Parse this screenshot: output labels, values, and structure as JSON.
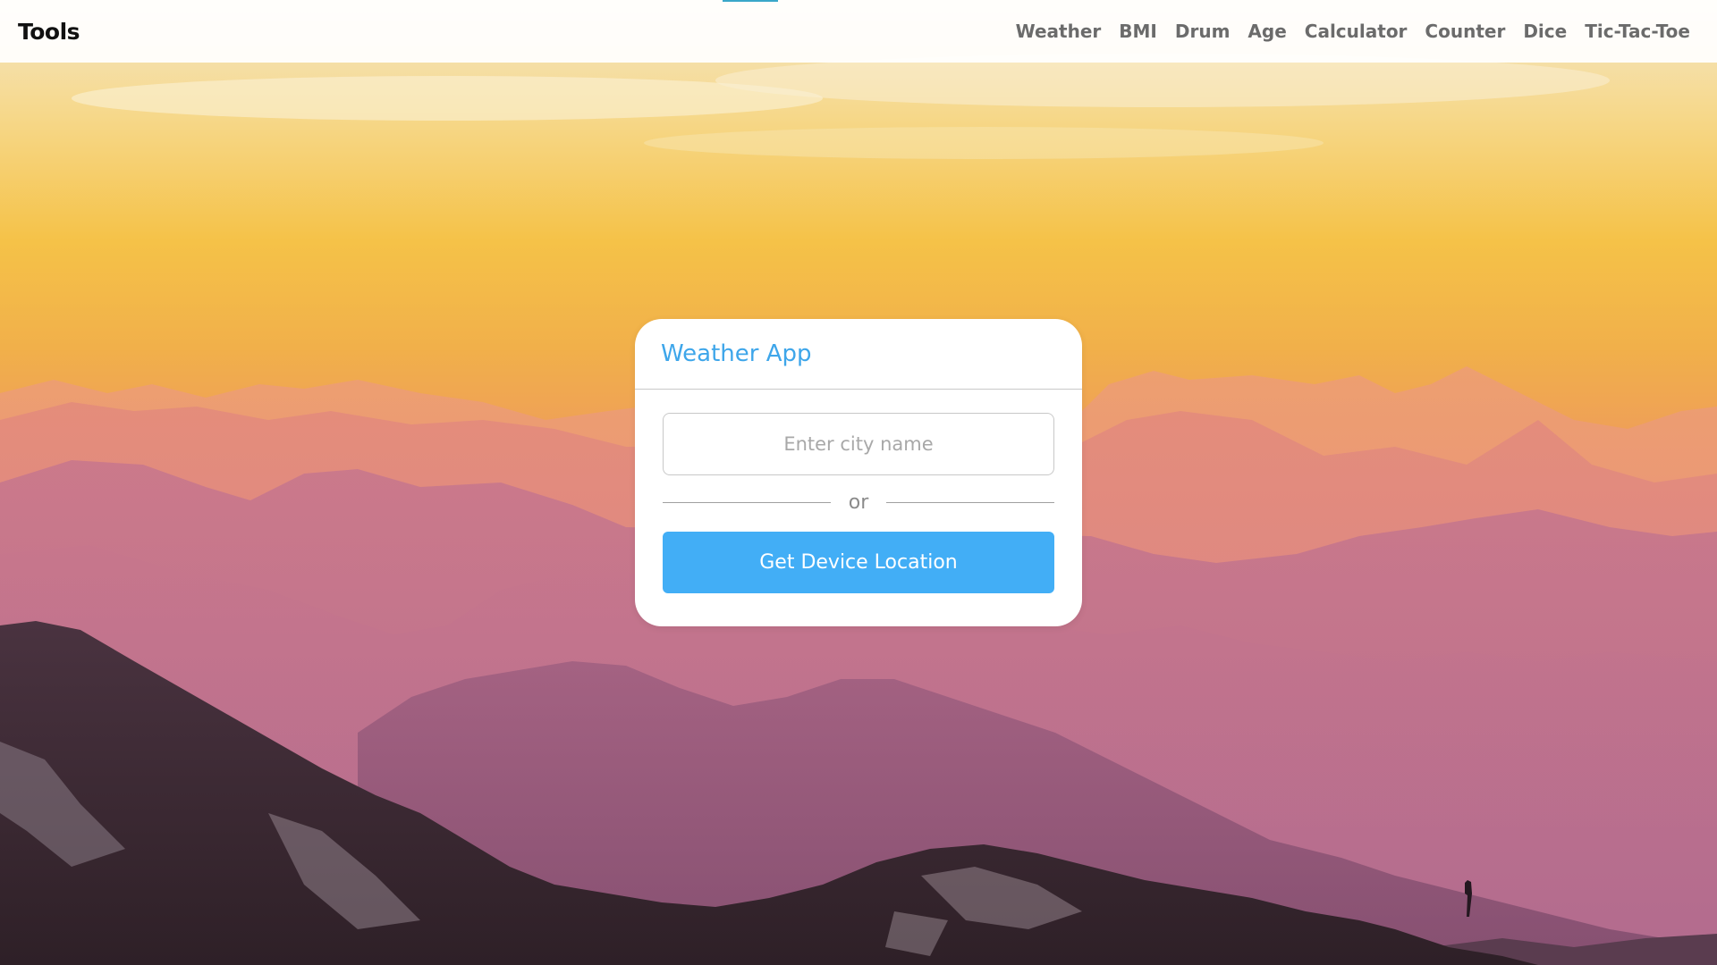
{
  "navbar": {
    "brand": "Tools",
    "links": [
      "Weather",
      "BMI",
      "Drum",
      "Age",
      "Calculator",
      "Counter",
      "Dice",
      "Tic-Tac-Toe"
    ]
  },
  "card": {
    "title": "Weather App",
    "city_input": {
      "placeholder": "Enter city name",
      "value": ""
    },
    "or_label": "or",
    "location_button": "Get Device Location"
  },
  "colors": {
    "accent": "#42aef6",
    "title": "#3ea6ea",
    "nav_text": "#6b6b6b"
  },
  "background": {
    "description_icon": "mountain-sunset-photo"
  }
}
